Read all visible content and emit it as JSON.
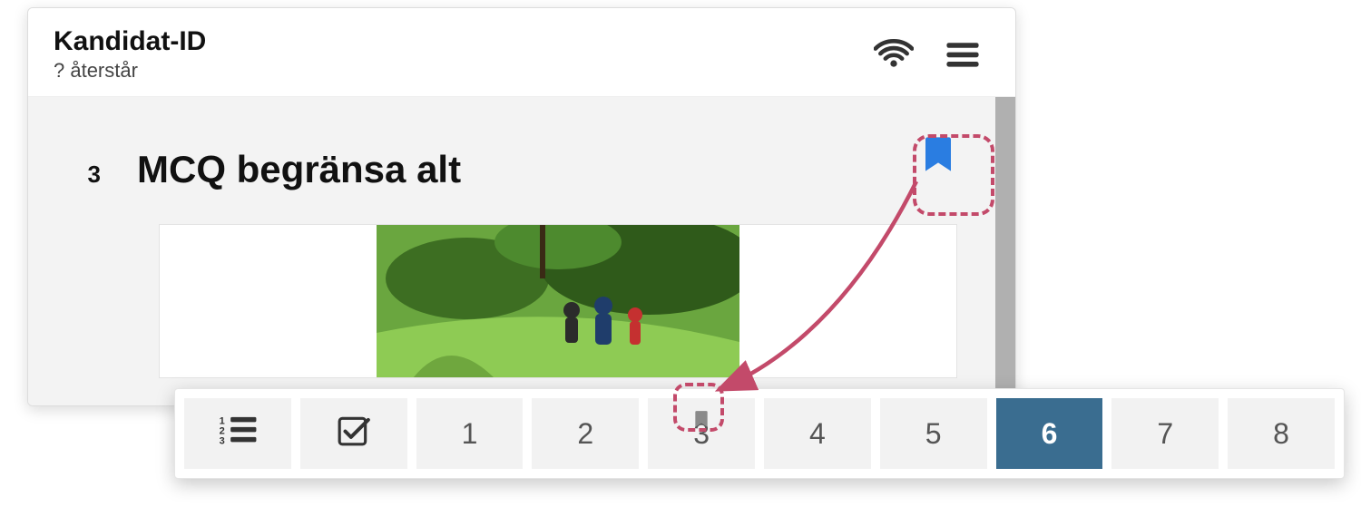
{
  "header": {
    "candidate_id_label": "Kandidat-ID",
    "remaining_text": "? återstår"
  },
  "question": {
    "number": "3",
    "title": "MCQ begränsa alt"
  },
  "flag": {
    "active": true
  },
  "nav": {
    "items": [
      {
        "kind": "list-icon"
      },
      {
        "kind": "check-icon"
      },
      {
        "kind": "number",
        "label": "1"
      },
      {
        "kind": "number",
        "label": "2"
      },
      {
        "kind": "number",
        "label": "3",
        "flagged": true
      },
      {
        "kind": "number",
        "label": "4"
      },
      {
        "kind": "number",
        "label": "5"
      },
      {
        "kind": "number",
        "label": "6",
        "active": true
      },
      {
        "kind": "number",
        "label": "7"
      },
      {
        "kind": "number",
        "label": "8"
      }
    ]
  },
  "colors": {
    "highlight": "#c34a6a",
    "flag_active": "#2a7de1",
    "nav_active_bg": "#3a6d90"
  }
}
